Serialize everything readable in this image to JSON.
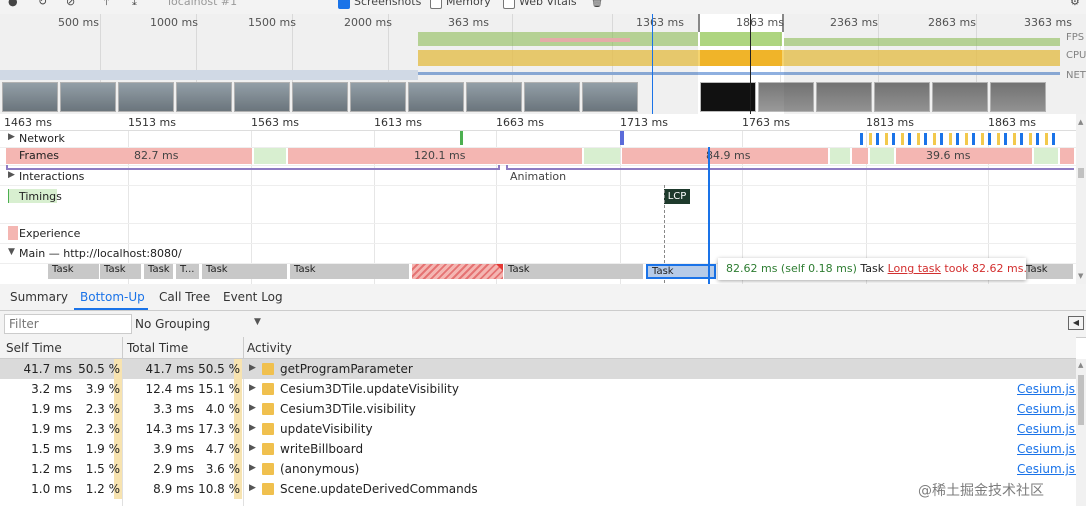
{
  "toolbar": {
    "url_select": "localhost #1",
    "screenshots_label": "Screenshots",
    "screenshots_checked": true,
    "memory_label": "Memory",
    "memory_checked": false,
    "webvitals_label": "Web Vitals",
    "webvitals_checked": false
  },
  "overview": {
    "ticks_left": [
      "500 ms",
      "1000 ms",
      "1500 ms",
      "2000 ms"
    ],
    "ticks_right": [
      "363 ms",
      "863 ms",
      "1363 ms",
      "1863 ms",
      "2363 ms",
      "2863 ms",
      "3363 ms"
    ],
    "lane_labels": {
      "fps": "FPS",
      "cpu": "CPU",
      "net": "NET"
    }
  },
  "ruler": {
    "ticks": [
      "1463 ms",
      "1513 ms",
      "1563 ms",
      "1613 ms",
      "1663 ms",
      "1713 ms",
      "1763 ms",
      "1813 ms",
      "1863 ms"
    ]
  },
  "tracks": {
    "network": "Network",
    "frames": "Frames",
    "frame_durations": [
      "82.7 ms",
      "120.1 ms",
      "84.9 ms",
      "39.6 ms"
    ],
    "interactions": "Interactions",
    "animation": "Animation",
    "timings": "Timings",
    "lcp": "LCP",
    "experience": "Experience",
    "main": "Main — http://localhost:8080/",
    "tasks": [
      "Task",
      "Task",
      "Task",
      "T...",
      "Task",
      "Task",
      "Task",
      "Task",
      "Task"
    ]
  },
  "tooltip": {
    "duration": "82.62 ms (self 0.18 ms)",
    "name": "Task",
    "long_task": "Long task",
    "took": "took 82.62 ms."
  },
  "panel_tabs": [
    "Summary",
    "Bottom-Up",
    "Call Tree",
    "Event Log"
  ],
  "active_tab": "Bottom-Up",
  "filter": {
    "placeholder": "Filter",
    "grouping": "No Grouping"
  },
  "columns": {
    "self_time": "Self Time",
    "total_time": "Total Time",
    "activity": "Activity"
  },
  "rows": [
    {
      "self": "41.7 ms",
      "self_pct": "50.5 %",
      "total": "41.7 ms",
      "total_pct": "50.5 %",
      "activity": "getProgramParameter",
      "source": ""
    },
    {
      "self": "3.2 ms",
      "self_pct": "3.9 %",
      "total": "12.4 ms",
      "total_pct": "15.1 %",
      "activity": "Cesium3DTile.updateVisibility",
      "source": "Cesium.js:1"
    },
    {
      "self": "1.9 ms",
      "self_pct": "2.3 %",
      "total": "3.3 ms",
      "total_pct": "4.0 %",
      "activity": "Cesium3DTile.visibility",
      "source": "Cesium.js:1"
    },
    {
      "self": "1.9 ms",
      "self_pct": "2.3 %",
      "total": "14.3 ms",
      "total_pct": "17.3 %",
      "activity": "updateVisibility",
      "source": "Cesium.js:1"
    },
    {
      "self": "1.5 ms",
      "self_pct": "1.9 %",
      "total": "3.9 ms",
      "total_pct": "4.7 %",
      "activity": "writeBillboard",
      "source": "Cesium.js:1"
    },
    {
      "self": "1.2 ms",
      "self_pct": "1.5 %",
      "total": "2.9 ms",
      "total_pct": "3.6 %",
      "activity": "(anonymous)",
      "source": "Cesium.js:1"
    },
    {
      "self": "1.0 ms",
      "self_pct": "1.2 %",
      "total": "8.9 ms",
      "total_pct": "10.8 %",
      "activity": "Scene.updateDerivedCommands",
      "source": ""
    }
  ],
  "watermark": "@稀土掘金技术社区"
}
